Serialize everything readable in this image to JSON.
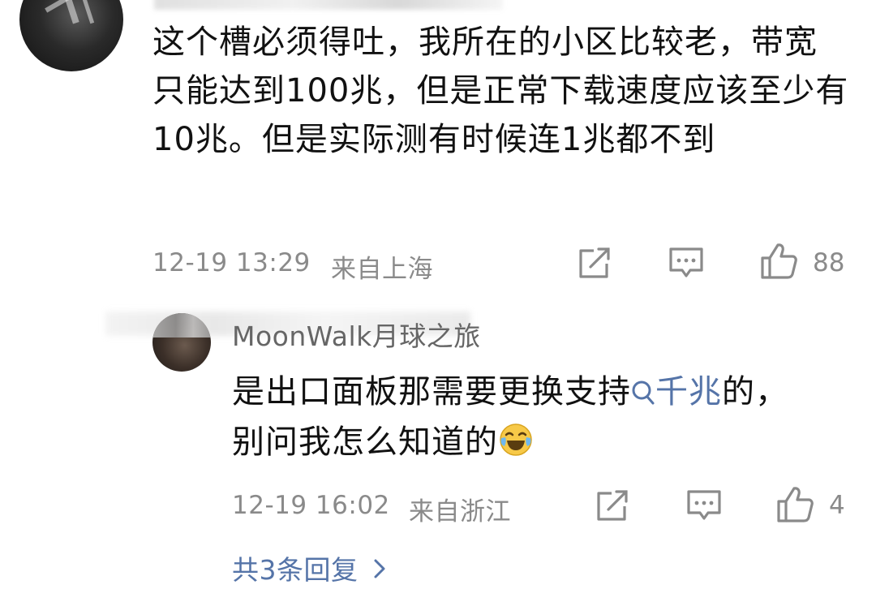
{
  "main_comment": {
    "text": "这个槽必须得吐，我所在的小区比较老，带宽只能达到100兆，但是正常下载速度应该至少有10兆。但是实际测有时候连1兆都不到",
    "date_time": "12-19 13:29",
    "location": "来自上海",
    "like_count": "88",
    "icons": [
      "share-icon",
      "comment-icon",
      "like-icon"
    ]
  },
  "reply": {
    "username": "MoonWalk月球之旅",
    "text_before_link": "是出口面板那需要更换支持",
    "search_link": "千兆",
    "text_after_link": "的，别问我怎么知道的",
    "emoji": "laugh-cry-emoji",
    "date_time": "12-19 16:02",
    "location": "来自浙江",
    "like_count": "4",
    "icons": [
      "share-icon",
      "comment-icon",
      "like-icon"
    ]
  },
  "more_replies_label": "共3条回复",
  "colors": {
    "text": "#111111",
    "meta_gray": "#8a8a8a",
    "link_blue": "#5574a8"
  }
}
